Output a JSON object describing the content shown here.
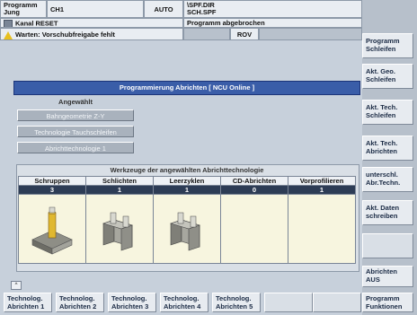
{
  "header": {
    "mode_line1": "Programm",
    "mode_line2": "Jung",
    "channel": "CH1",
    "op_mode": "AUTO",
    "path_line1": "\\SPF.DIR",
    "path_line2": "SCH.SPF",
    "channel_status": "Kanal RESET",
    "program_status": "Programm abgebrochen",
    "alarm_text": "Warten: Vorschubfreigabe fehlt",
    "rov": "ROV"
  },
  "dialog": {
    "title": "Programmierung Abrichten [ NCU Online ]",
    "selected_heading": "Angewählt",
    "selected_items": [
      "Bahngeometrie Z-Y",
      "Technologie Tauchschleifen",
      "Abrichttechnologie 1"
    ],
    "tools_heading": "Werkzeuge der angewählten Abrichttechnologie",
    "columns": [
      "Schruppen",
      "Schlichten",
      "Leerzyklen",
      "CD-Abrichten",
      "Vorprofilieren"
    ],
    "counts": [
      "3",
      "1",
      "1",
      "0",
      "1"
    ]
  },
  "vertical_softkeys": [
    {
      "label": "Programm Schleifen"
    },
    {
      "label": "Akt. Geo. Schleifen"
    },
    {
      "label": "Akt. Tech. Schleifen"
    },
    {
      "label": "Akt. Tech. Abrichten"
    },
    {
      "label": "unterschl. Abr.Techn."
    },
    {
      "label": "Akt. Daten schreiben"
    },
    {
      "label": ""
    },
    {
      "label": "Abrichten AUS"
    }
  ],
  "horizontal_softkeys": [
    {
      "label": "Technolog. Abrichten 1"
    },
    {
      "label": "Technolog. Abrichten 2"
    },
    {
      "label": "Technolog. Abrichten 3"
    },
    {
      "label": "Technolog. Abrichten 4"
    },
    {
      "label": "Technolog. Abrichten 5"
    },
    {
      "label": ""
    },
    {
      "label": ""
    },
    {
      "label": "Programm Funktionen"
    }
  ],
  "colors": {
    "title_bar": "#3a5da8",
    "count_row": "#2d3c55",
    "image_cells": "#f7f5df"
  }
}
